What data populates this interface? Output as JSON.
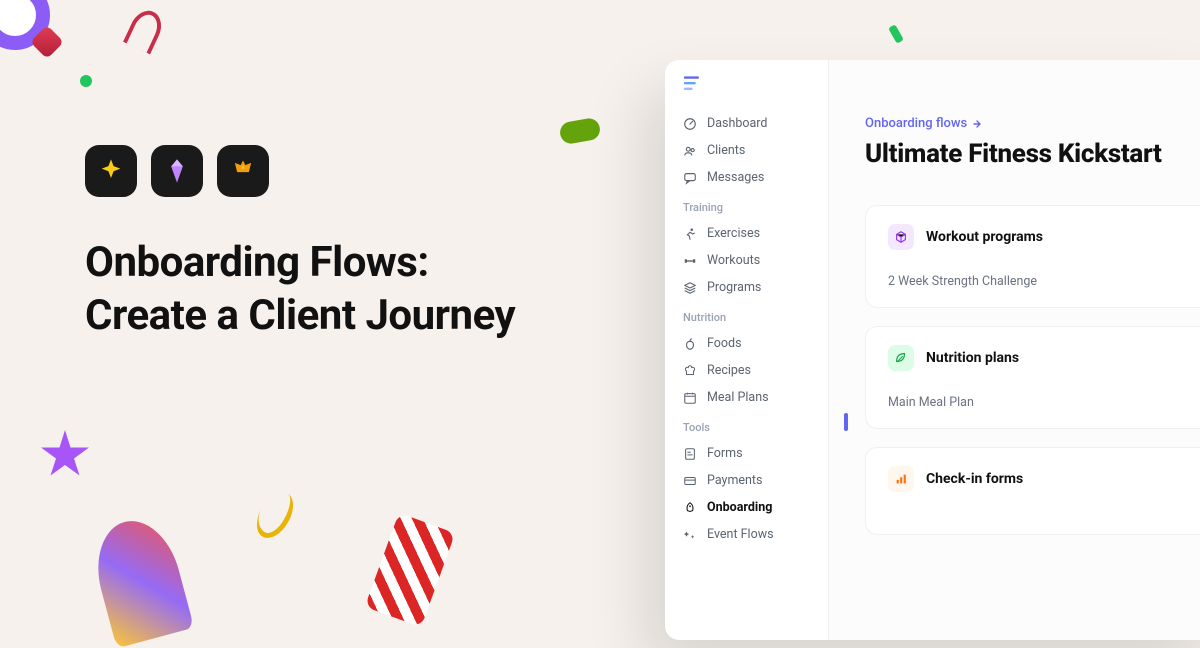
{
  "hero": {
    "title_line1": "Onboarding Flows:",
    "title_line2": "Create a Client Journey"
  },
  "sidebar": {
    "groups": [
      {
        "label": null,
        "items": [
          {
            "label": "Dashboard",
            "icon": "gauge-icon",
            "active": false
          },
          {
            "label": "Clients",
            "icon": "users-icon",
            "active": false
          },
          {
            "label": "Messages",
            "icon": "messages-icon",
            "active": false
          }
        ]
      },
      {
        "label": "Training",
        "items": [
          {
            "label": "Exercises",
            "icon": "run-icon",
            "active": false
          },
          {
            "label": "Workouts",
            "icon": "dumbbell-icon",
            "active": false
          },
          {
            "label": "Programs",
            "icon": "stack-icon",
            "active": false
          }
        ]
      },
      {
        "label": "Nutrition",
        "items": [
          {
            "label": "Foods",
            "icon": "apple-icon",
            "active": false
          },
          {
            "label": "Recipes",
            "icon": "chef-icon",
            "active": false
          },
          {
            "label": "Meal Plans",
            "icon": "calendar-meal-icon",
            "active": false
          }
        ]
      },
      {
        "label": "Tools",
        "items": [
          {
            "label": "Forms",
            "icon": "form-icon",
            "active": false
          },
          {
            "label": "Payments",
            "icon": "card-icon",
            "active": false
          },
          {
            "label": "Onboarding",
            "icon": "rocket-icon",
            "active": true
          },
          {
            "label": "Event Flows",
            "icon": "sparkle-flow-icon",
            "active": false
          }
        ]
      }
    ]
  },
  "main": {
    "breadcrumb": "Onboarding flows",
    "title": "Ultimate Fitness Kickstart",
    "cards": [
      {
        "title": "Workout programs",
        "sub": "2 Week Strength Challenge",
        "icon": "cube-icon",
        "tone": "purple"
      },
      {
        "title": "Nutrition plans",
        "sub": "Main Meal Plan",
        "icon": "leaf-icon",
        "tone": "green"
      },
      {
        "title": "Check-in forms",
        "sub": "",
        "icon": "bars-icon",
        "tone": "orange"
      }
    ]
  }
}
